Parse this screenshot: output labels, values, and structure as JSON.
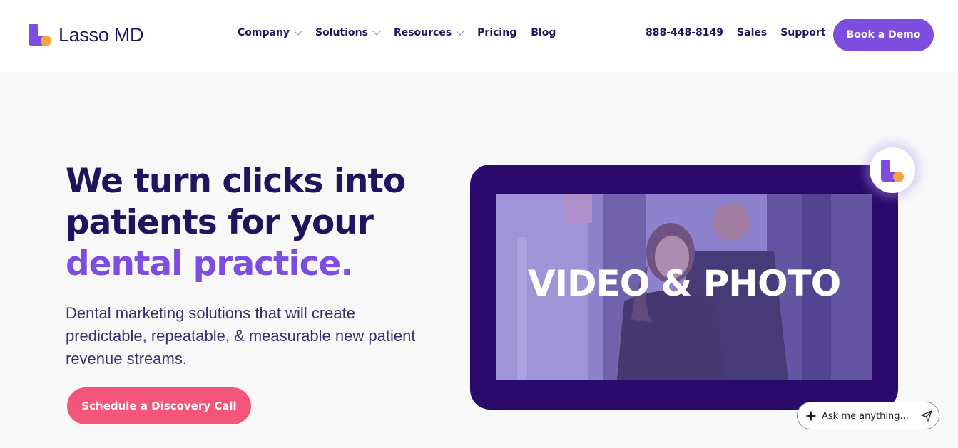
{
  "brand": {
    "name": "Lasso MD",
    "purple": "#7c4dde",
    "navy": "#21135e",
    "orange": "#f7a23a",
    "pink": "#f4567a"
  },
  "nav": {
    "items": [
      {
        "label": "Company",
        "dropdown": true
      },
      {
        "label": "Solutions",
        "dropdown": true
      },
      {
        "label": "Resources",
        "dropdown": true
      },
      {
        "label": "Pricing",
        "dropdown": false
      },
      {
        "label": "Blog",
        "dropdown": false
      }
    ],
    "phone": "888-448-8149",
    "sales": "Sales",
    "support": "Support",
    "cta": "Book a Demo"
  },
  "hero": {
    "title_line1": "We turn clicks into",
    "title_line2": "patients for your",
    "title_accent": "dental practice.",
    "subtitle": "Dental marketing solutions that will create predictable, repeatable, & measurable new patient revenue streams.",
    "cta": "Schedule a Discovery Call"
  },
  "video": {
    "overlay_text": "VIDEO & PHOTO"
  },
  "chat": {
    "placeholder": "Ask me anything...",
    "icon": "sparkle-icon",
    "send_icon": "send-icon"
  }
}
